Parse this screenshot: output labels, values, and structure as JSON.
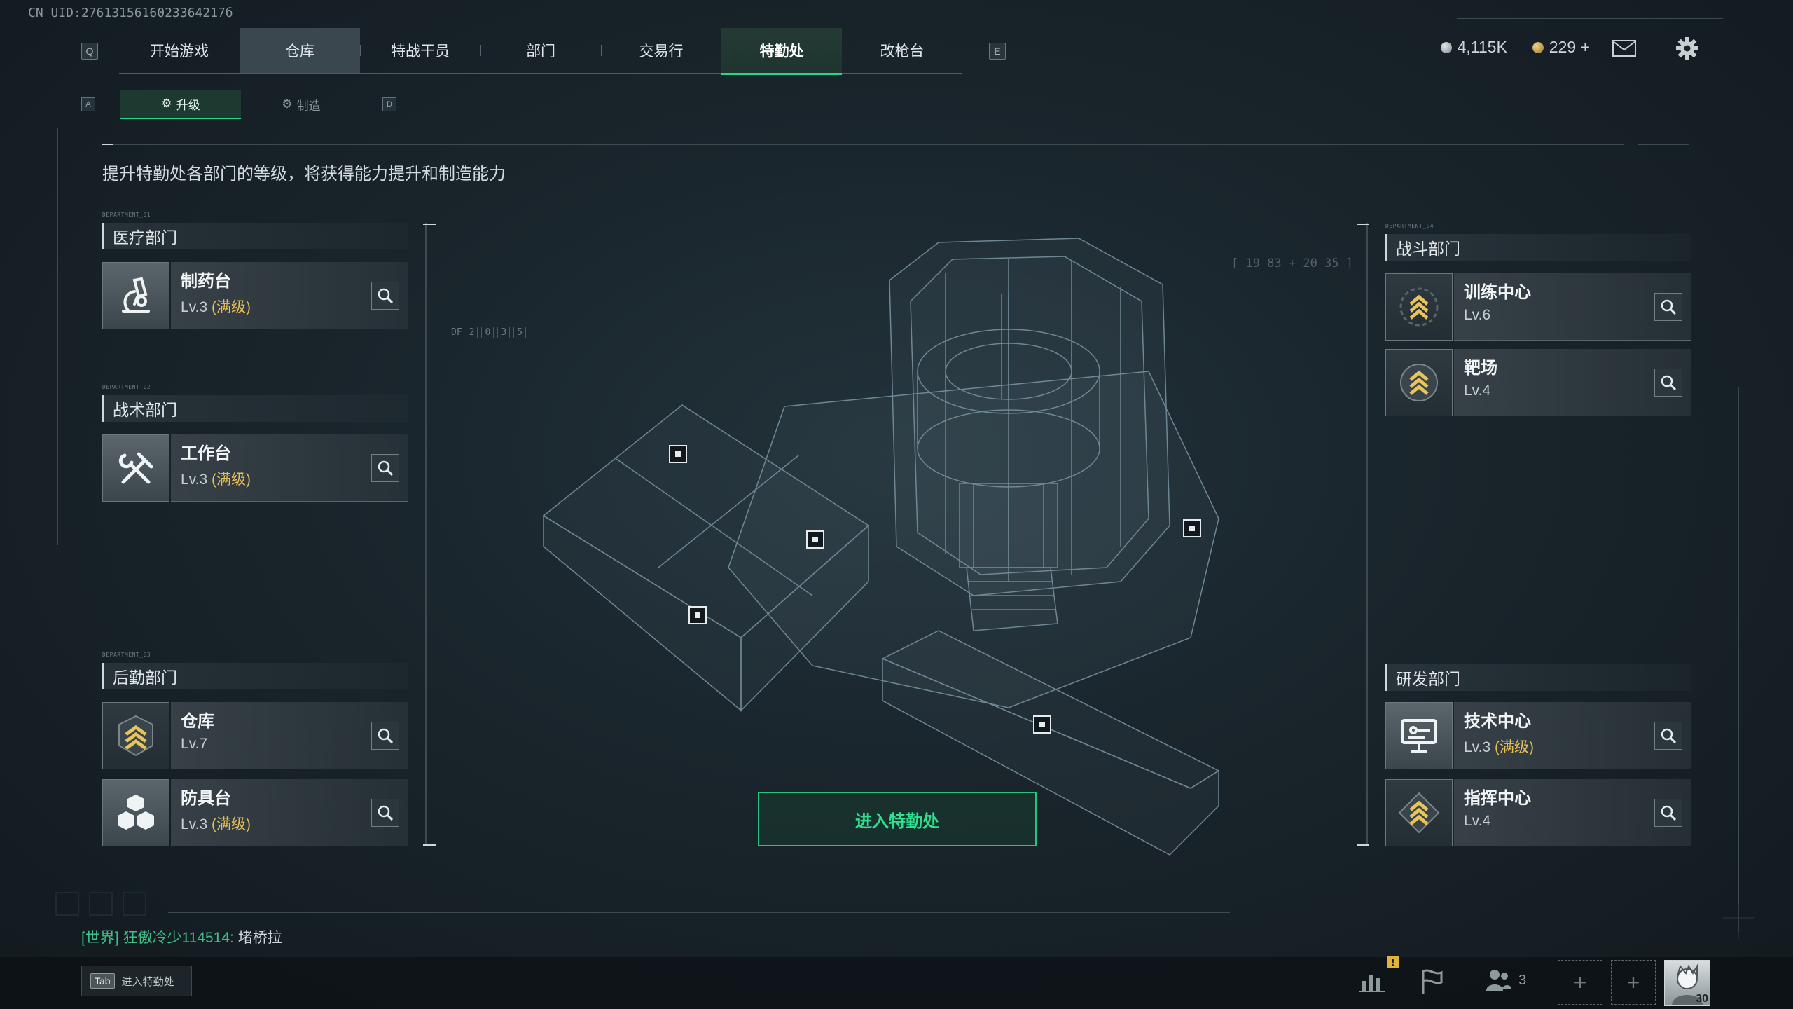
{
  "uid": "CN UID:2761315616023364217б",
  "top_nav": {
    "key_left": "Q",
    "key_right": "E",
    "tabs": [
      {
        "label": "开始游戏"
      },
      {
        "label": "仓库"
      },
      {
        "label": "特战干员"
      },
      {
        "label": "部门"
      },
      {
        "label": "交易行"
      },
      {
        "label": "特勤处"
      },
      {
        "label": "改枪台"
      }
    ]
  },
  "currency": {
    "silver": "4,115K",
    "gold": "229",
    "add": "+"
  },
  "sub_nav": {
    "key_left": "A",
    "key_right": "D",
    "tabs": [
      {
        "label": "升级"
      },
      {
        "label": "制造"
      }
    ]
  },
  "description": "提升特勤处各部门的等级，将获得能力提升和制造能力",
  "departments": {
    "medical": {
      "tag": "DEPARTMENT_01",
      "title": "医疗部门",
      "items": [
        {
          "name": "制药台",
          "level": "Lv.3",
          "max": "(满级)"
        }
      ]
    },
    "tactical": {
      "tag": "DEPARTMENT_02",
      "title": "战术部门",
      "items": [
        {
          "name": "工作台",
          "level": "Lv.3",
          "max": "(满级)"
        }
      ]
    },
    "logistics": {
      "tag": "DEPARTMENT_03",
      "title": "后勤部门",
      "items": [
        {
          "name": "仓库",
          "level": "Lv.7",
          "max": ""
        },
        {
          "name": "防具台",
          "level": "Lv.3",
          "max": "(满级)"
        }
      ]
    },
    "combat": {
      "tag": "DEPARTMENT_04",
      "title": "战斗部门",
      "items": [
        {
          "name": "训练中心",
          "level": "Lv.6",
          "max": ""
        },
        {
          "name": "靶场",
          "level": "Lv.4",
          "max": ""
        }
      ]
    },
    "research": {
      "title": "研发部门",
      "items": [
        {
          "name": "技术中心",
          "level": "Lv.3",
          "max": "(满级)"
        },
        {
          "name": "指挥中心",
          "level": "Lv.4",
          "max": ""
        }
      ]
    }
  },
  "center": {
    "coords": "[ 19 83 + 20 35 ]",
    "df_label": "DF",
    "df_digits": [
      "2",
      "0",
      "3",
      "5"
    ],
    "enter_button": "进入特勤处"
  },
  "chat": {
    "channel": "[世界]",
    "user": "狂傲冷少114514:",
    "message": "堵桥拉"
  },
  "bottom": {
    "tab_key": "Tab",
    "tab_hint": "进入特勤处",
    "friends_count": "3",
    "alert": "!",
    "avatar_level": "30"
  },
  "colors": {
    "accent_green": "#27d68a",
    "max_level_gold": "#e7bf57",
    "background": "#19242b"
  }
}
